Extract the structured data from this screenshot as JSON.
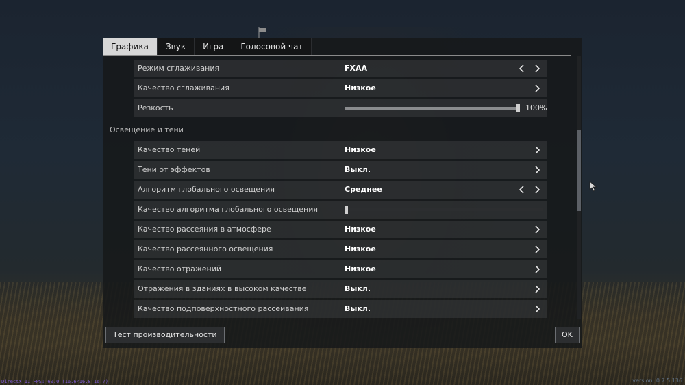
{
  "tabs": [
    {
      "label": "Графика",
      "active": true
    },
    {
      "label": "Звук",
      "active": false
    },
    {
      "label": "Игра",
      "active": false
    },
    {
      "label": "Голосовой чат",
      "active": false
    }
  ],
  "rows_top": [
    {
      "label": "Режим сглаживания",
      "value": "FXAA",
      "left_arrow": true,
      "right_arrow": true
    },
    {
      "label": "Качество сглаживания",
      "value": "Низкое",
      "left_arrow": false,
      "right_arrow": true
    }
  ],
  "sharpness": {
    "label": "Резкость",
    "value_text": "100%",
    "level": 1.0
  },
  "section_lighting": {
    "title": "Освещение и тени"
  },
  "rows_lighting_a": [
    {
      "label": "Качество теней",
      "value": "Низкое",
      "left_arrow": false,
      "right_arrow": true
    },
    {
      "label": "Тени от эффектов",
      "value": "Выкл.",
      "left_arrow": false,
      "right_arrow": true
    },
    {
      "label": "Алгоритм глобального освещения",
      "value": "Среднее",
      "left_arrow": true,
      "right_arrow": true
    }
  ],
  "gi_quality": {
    "label": "Качество алгоритма глобального освещения",
    "level": 0.0
  },
  "rows_lighting_b": [
    {
      "label": "Качество рассеяния в атмосфере",
      "value": "Низкое",
      "left_arrow": false,
      "right_arrow": true
    },
    {
      "label": "Качество рассеянного освещения",
      "value": "Низкое",
      "left_arrow": false,
      "right_arrow": true
    },
    {
      "label": "Качество отражений",
      "value": "Низкое",
      "left_arrow": false,
      "right_arrow": true
    },
    {
      "label": "Отражения в зданиях в высоком качестве",
      "value": "Выкл.",
      "left_arrow": false,
      "right_arrow": true
    },
    {
      "label": "Качество подповерхностного рассеивания",
      "value": "Выкл.",
      "left_arrow": false,
      "right_arrow": true
    }
  ],
  "footer": {
    "benchmark_label": "Тест производительности",
    "ok_label": "OK"
  },
  "status": {
    "fps_text": "DirectX 11 FPS: 60.0 (16.6<16.8 16.7)",
    "version_text": "version: 0.7.5.136"
  },
  "colors": {
    "active_tab": "#d7d7d7",
    "row_bg": "#3a3c3e",
    "panel_bg": "#16181a"
  }
}
